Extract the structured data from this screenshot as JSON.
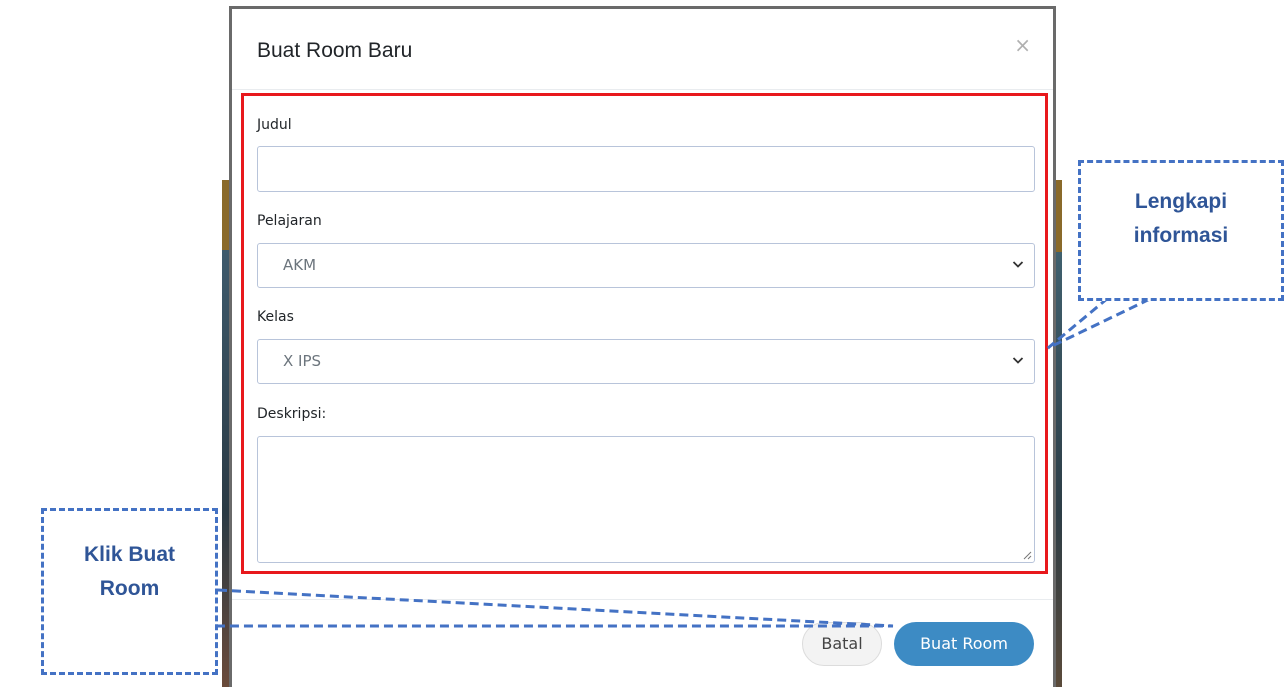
{
  "modal": {
    "title": "Buat Room Baru",
    "close_symbol": "×"
  },
  "form": {
    "judul": {
      "label": "Judul",
      "value": ""
    },
    "pelajaran": {
      "label": "Pelajaran",
      "selected": "AKM"
    },
    "kelas": {
      "label": "Kelas",
      "selected": "X IPS"
    },
    "deskripsi": {
      "label": "Deskripsi:",
      "value": ""
    }
  },
  "footer": {
    "cancel_label": "Batal",
    "submit_label": "Buat Room"
  },
  "annotations": {
    "complete_info": {
      "line1": "Lengkapi",
      "line2": "informasi"
    },
    "click_create": {
      "line1": "Klik Buat",
      "line2": "Room"
    }
  },
  "colors": {
    "highlight": "#e8181c",
    "callout": "#4472c4",
    "primary_button": "#3d8bc4"
  },
  "icons": {
    "close": "close-icon",
    "select_arrow": "chevron-down-icon",
    "resize": "resize-grip-icon"
  }
}
